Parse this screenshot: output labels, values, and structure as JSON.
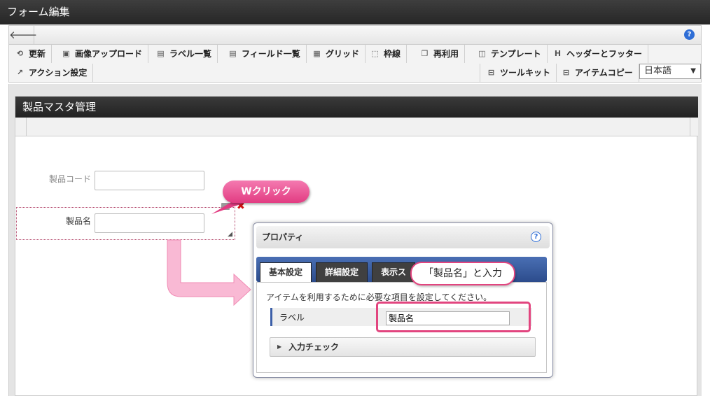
{
  "window": {
    "title": "フォーム編集"
  },
  "nav": {
    "back_symbol": "🡐",
    "help_symbol": "?"
  },
  "toolbar": {
    "row1": [
      {
        "label": "更新",
        "icon": "refresh-icon"
      },
      {
        "label": "画像アップロード",
        "icon": "image-upload-icon"
      },
      {
        "label": "ラベル一覧",
        "icon": "label-list-icon"
      },
      {
        "label": "フィールド一覧",
        "icon": "field-list-icon"
      },
      {
        "label": "グリッド",
        "icon": "grid-icon"
      },
      {
        "label": "枠線",
        "icon": "border-icon"
      },
      {
        "label": "再利用",
        "icon": "reuse-icon"
      },
      {
        "label": "テンプレート",
        "icon": "template-icon"
      },
      {
        "label": "ヘッダーとフッター",
        "icon": "header-footer-icon"
      }
    ],
    "row2_left": {
      "label": "アクション設定",
      "icon": "action-settings-icon"
    },
    "row2_right": [
      {
        "label": "ツールキット",
        "icon": "toolkit-icon"
      },
      {
        "label": "アイテムコピー",
        "icon": "item-copy-icon"
      }
    ],
    "language": "日本語"
  },
  "form": {
    "title": "製品マスタ管理",
    "fields": [
      {
        "label": "製品コード",
        "value": ""
      },
      {
        "label": "製品名",
        "value": ""
      }
    ]
  },
  "annotations": {
    "double_click": "Wクリック",
    "enter_hint": "「製品名」と入力"
  },
  "properties": {
    "title": "プロパティ",
    "tabs": [
      "基本設定",
      "詳細設定",
      "表示ス"
    ],
    "description": "アイテムを利用するために必要な項目を設定してください。",
    "label_name": "ラベル",
    "label_value": "製品名",
    "input_check": "入力チェック"
  },
  "colors": {
    "accent_pink": "#e2457f",
    "tab_blue": "#2c4c8c",
    "header_dark": "#262626"
  }
}
